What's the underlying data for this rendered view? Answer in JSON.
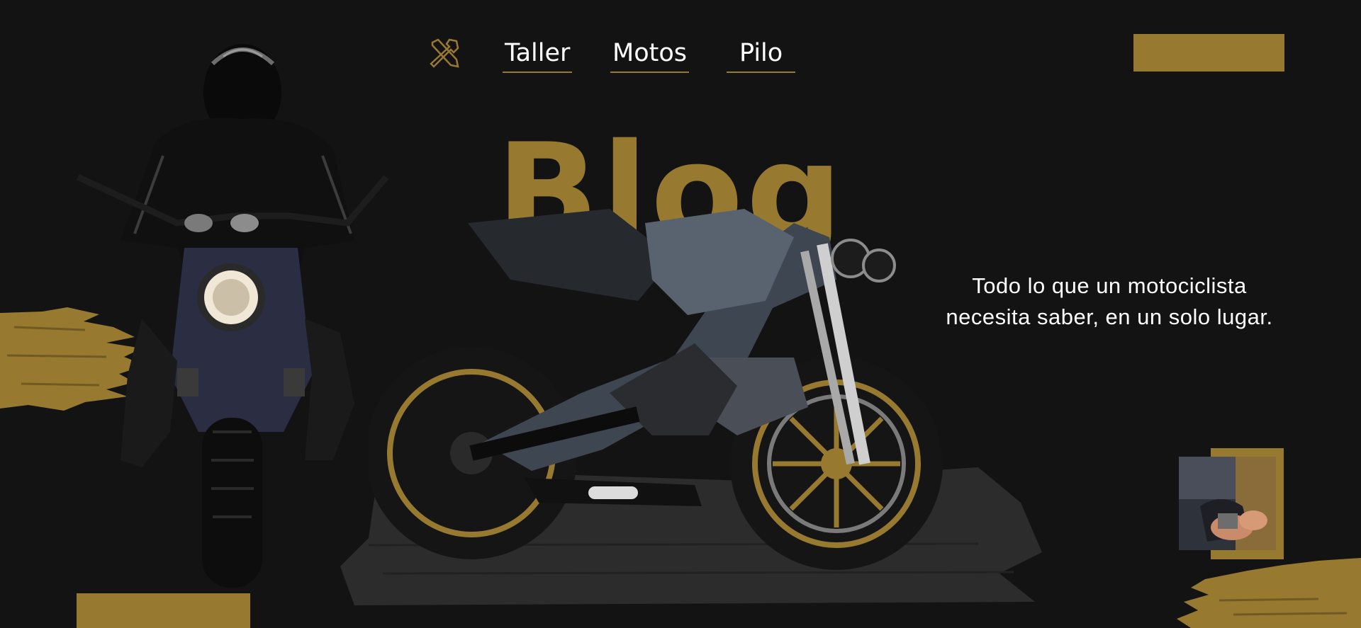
{
  "nav": {
    "icon": "tools-icon",
    "links": [
      "Taller",
      "Motos",
      "Pilo"
    ]
  },
  "hero": {
    "title": "Blog",
    "tagline_line1": "Todo lo que un motociclista",
    "tagline_line2": "necesita saber, en un solo lugar."
  },
  "colors": {
    "background": "#131313",
    "accent": "#987930",
    "text": "#ffffff"
  },
  "images": {
    "rider": "motorcyclist-front-photo",
    "bike": "buell-motorcycle-photo",
    "thumbnail": "mechanic-hands-thumbnail"
  }
}
